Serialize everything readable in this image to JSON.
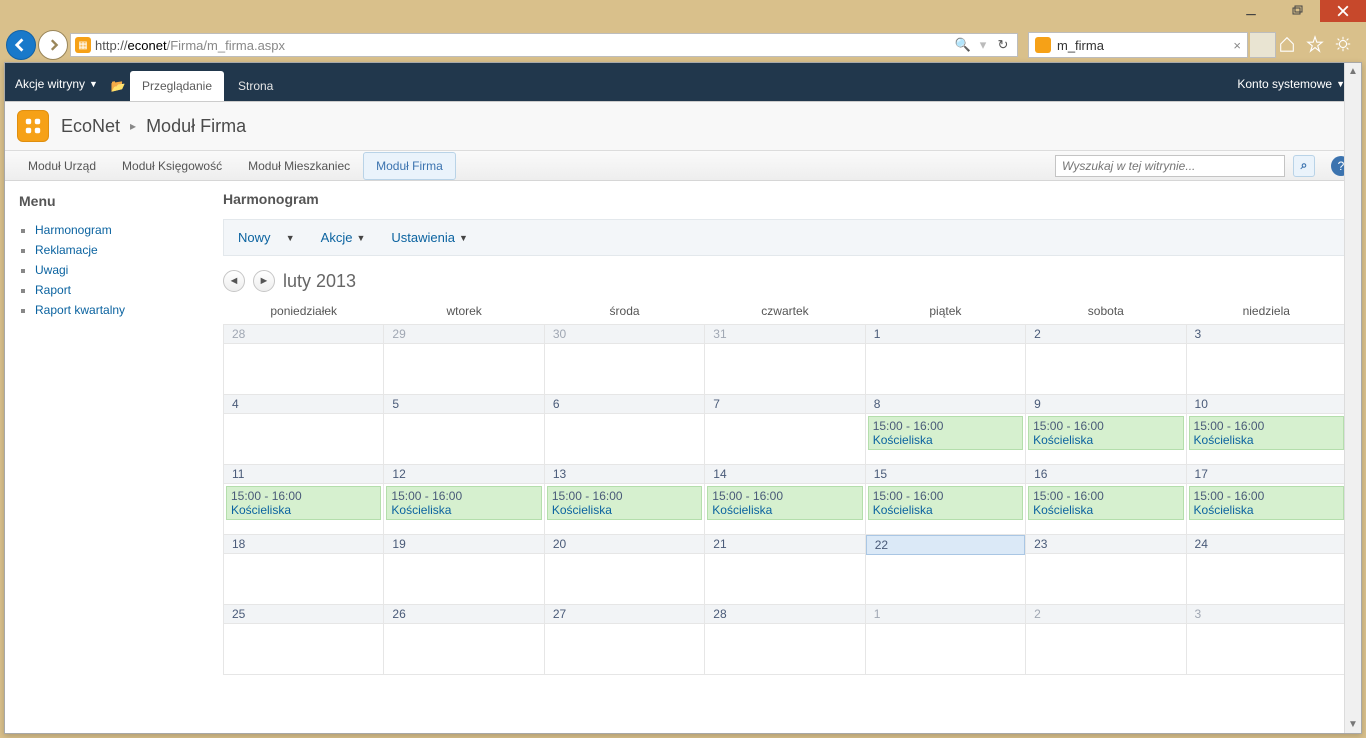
{
  "browser": {
    "url_host": "econet",
    "url_prefix": "http://",
    "url_path": "/Firma/m_firma.aspx",
    "tab_title": "m_firma"
  },
  "ribbon": {
    "site_actions": "Akcje witryny",
    "tab_browse": "Przeglądanie",
    "tab_page": "Strona",
    "account": "Konto systemowe"
  },
  "breadcrumb": {
    "root": "EcoNet",
    "current": "Moduł Firma"
  },
  "modtabs": {
    "items": [
      "Moduł Urząd",
      "Moduł Księgowość",
      "Moduł Mieszkaniec",
      "Moduł Firma"
    ],
    "active_index": 3,
    "search_placeholder": "Wyszukaj w tej witrynie..."
  },
  "side": {
    "header": "Menu",
    "items": [
      "Harmonogram",
      "Reklamacje",
      "Uwagi",
      "Raport",
      "Raport kwartalny"
    ]
  },
  "main": {
    "title": "Harmonogram",
    "toolbar": {
      "new": "Nowy",
      "actions": "Akcje",
      "settings": "Ustawienia"
    },
    "month_label": "luty 2013",
    "day_headers": [
      "poniedziałek",
      "wtorek",
      "środa",
      "czwartek",
      "piątek",
      "sobota",
      "niedziela"
    ],
    "event_time": "15:00 - 16:00",
    "event_loc": "Kościeliska",
    "weeks": [
      [
        {
          "n": "28",
          "out": true
        },
        {
          "n": "29",
          "out": true
        },
        {
          "n": "30",
          "out": true
        },
        {
          "n": "31",
          "out": true
        },
        {
          "n": "1"
        },
        {
          "n": "2"
        },
        {
          "n": "3"
        }
      ],
      [
        {
          "n": "4"
        },
        {
          "n": "5"
        },
        {
          "n": "6"
        },
        {
          "n": "7"
        },
        {
          "n": "8",
          "evt": true
        },
        {
          "n": "9",
          "evt": true
        },
        {
          "n": "10",
          "evt": true
        }
      ],
      [
        {
          "n": "11",
          "evt": true
        },
        {
          "n": "12",
          "evt": true
        },
        {
          "n": "13",
          "evt": true
        },
        {
          "n": "14",
          "evt": true
        },
        {
          "n": "15",
          "evt": true
        },
        {
          "n": "16",
          "evt": true
        },
        {
          "n": "17",
          "evt": true
        }
      ],
      [
        {
          "n": "18"
        },
        {
          "n": "19"
        },
        {
          "n": "20"
        },
        {
          "n": "21"
        },
        {
          "n": "22",
          "today": true
        },
        {
          "n": "23"
        },
        {
          "n": "24"
        }
      ],
      [
        {
          "n": "25"
        },
        {
          "n": "26"
        },
        {
          "n": "27"
        },
        {
          "n": "28"
        },
        {
          "n": "1",
          "out": true
        },
        {
          "n": "2",
          "out": true
        },
        {
          "n": "3",
          "out": true
        }
      ]
    ]
  }
}
